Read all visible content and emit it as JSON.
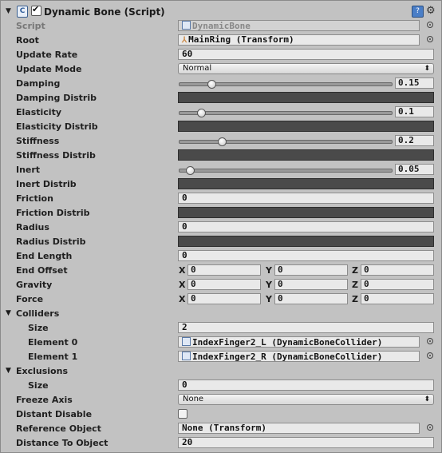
{
  "header": {
    "title": "Dynamic Bone (Script)",
    "enabled": true,
    "script_icon": "c#-script-icon",
    "help_icon": "help-icon",
    "gear_icon": "gear-icon"
  },
  "rows": {
    "script": {
      "label": "Script",
      "value": "DynamicBone"
    },
    "root": {
      "label": "Root",
      "value": "MainRing (Transform)"
    },
    "update_rate": {
      "label": "Update Rate",
      "value": "60"
    },
    "update_mode": {
      "label": "Update Mode",
      "value": "Normal"
    },
    "damping": {
      "label": "Damping",
      "value": "0.15",
      "fraction": 0.15
    },
    "damping_distrib": {
      "label": "Damping Distrib"
    },
    "elasticity": {
      "label": "Elasticity",
      "value": "0.1",
      "fraction": 0.1
    },
    "elasticity_distrib": {
      "label": "Elasticity Distrib"
    },
    "stiffness": {
      "label": "Stiffness",
      "value": "0.2",
      "fraction": 0.2
    },
    "stiffness_distrib": {
      "label": "Stiffness Distrib"
    },
    "inert": {
      "label": "Inert",
      "value": "0.05",
      "fraction": 0.05
    },
    "inert_distrib": {
      "label": "Inert Distrib"
    },
    "friction": {
      "label": "Friction",
      "value": "0"
    },
    "friction_distrib": {
      "label": "Friction Distrib"
    },
    "radius": {
      "label": "Radius",
      "value": "0"
    },
    "radius_distrib": {
      "label": "Radius Distrib"
    },
    "end_length": {
      "label": "End Length",
      "value": "0"
    },
    "end_offset": {
      "label": "End Offset",
      "x": "0",
      "y": "0",
      "z": "0"
    },
    "gravity": {
      "label": "Gravity",
      "x": "0",
      "y": "0",
      "z": "0"
    },
    "force": {
      "label": "Force",
      "x": "0",
      "y": "0",
      "z": "0"
    },
    "colliders": {
      "label": "Colliders",
      "size_label": "Size",
      "size": "2",
      "elements": [
        {
          "label": "Element 0",
          "value": "IndexFinger2_L (DynamicBoneCollider)"
        },
        {
          "label": "Element 1",
          "value": "IndexFinger2_R (DynamicBoneCollider)"
        }
      ]
    },
    "exclusions": {
      "label": "Exclusions",
      "size_label": "Size",
      "size": "0"
    },
    "freeze_axis": {
      "label": "Freeze Axis",
      "value": "None"
    },
    "distant_disable": {
      "label": "Distant Disable",
      "checked": false
    },
    "reference_object": {
      "label": "Reference Object",
      "value": "None (Transform)"
    },
    "distance_to_object": {
      "label": "Distance To Object",
      "value": "20"
    }
  },
  "axis_labels": {
    "x": "X",
    "y": "Y",
    "z": "Z"
  },
  "glyphs": {
    "foldout_open": "▼",
    "dropdown_arrow": "⬍"
  }
}
